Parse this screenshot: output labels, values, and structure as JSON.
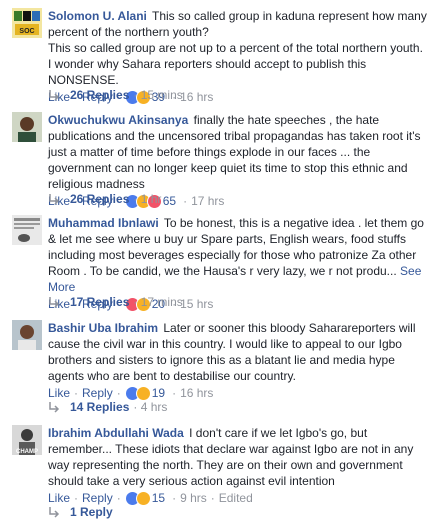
{
  "comments": [
    {
      "author": "Solomon U. Alani",
      "text": "This so called group in kaduna represent how many percent of the northern youth?",
      "text2": "This so called group are not up to a percent of the total northern youth. I wonder why Sahara reporters should accept to publish this NONSENSE.",
      "like": "Like",
      "reply": "Reply",
      "reactions": [
        "like",
        "haha"
      ],
      "count": "39",
      "time": "16 hrs",
      "replies_label": "26 Replies",
      "replies_time": "15 mins",
      "avatar_text": "SOC"
    },
    {
      "author": "Okwuchukwu Akinsanya",
      "text": "finally the hate speeches , the hate publications and the uncensored tribal propagandas has taken root it's just a matter of time before things explode in our faces ... the government can no longer keep quiet its time to stop this ethnic and religious madness",
      "like": "Like",
      "reply": "Reply",
      "reactions": [
        "like",
        "wow",
        "love"
      ],
      "count": "65",
      "time": "17 hrs",
      "replies_label": "26 Replies",
      "replies_time": "1 hr"
    },
    {
      "author": "Muhammad Ibnlawi",
      "text": "To be honest, this is a negative idea . let them go & let me see where u buy ur Spare parts, English wears, food stuffs including most beverages especially for those who patronize Za other Room . To be candid, we the Hausa's r very lazy, we r not produ...",
      "see_more": "See More",
      "like": "Like",
      "reply": "Reply",
      "reactions": [
        "love",
        "haha"
      ],
      "count": "20",
      "time": "15 hrs",
      "replies_label": "17 Replies",
      "replies_time": "17 mins"
    },
    {
      "author": "Bashir Uba Ibrahim",
      "text": "Later or sooner this bloody Saharareporters will cause the civil war in this country. I would like to appeal to our Igbo brothers and sisters to ignore this as a blatant lie and media hype agents who are bent to destabilise our country.",
      "like": "Like",
      "reply": "Reply",
      "reactions": [
        "like",
        "haha"
      ],
      "count": "19",
      "time": "16 hrs",
      "replies_label": "14 Replies",
      "replies_time": "4 hrs"
    },
    {
      "author": "Ibrahim Abdullahi Wada",
      "text": "I don't care if we let Igbo's go, but remember... These idiots that declare war against Igbo are not in any way representing the north. They are on their own and government should take a very serious action against evil intention",
      "like": "Like",
      "reply": "Reply",
      "reactions": [
        "like",
        "haha"
      ],
      "count": "15",
      "time": "9 hrs",
      "edited": "Edited",
      "replies_label": "1 Reply",
      "avatar_text": "CHAMP"
    }
  ],
  "colors": {
    "link": "#365899",
    "muted": "#90949c",
    "text": "#1d2129"
  }
}
